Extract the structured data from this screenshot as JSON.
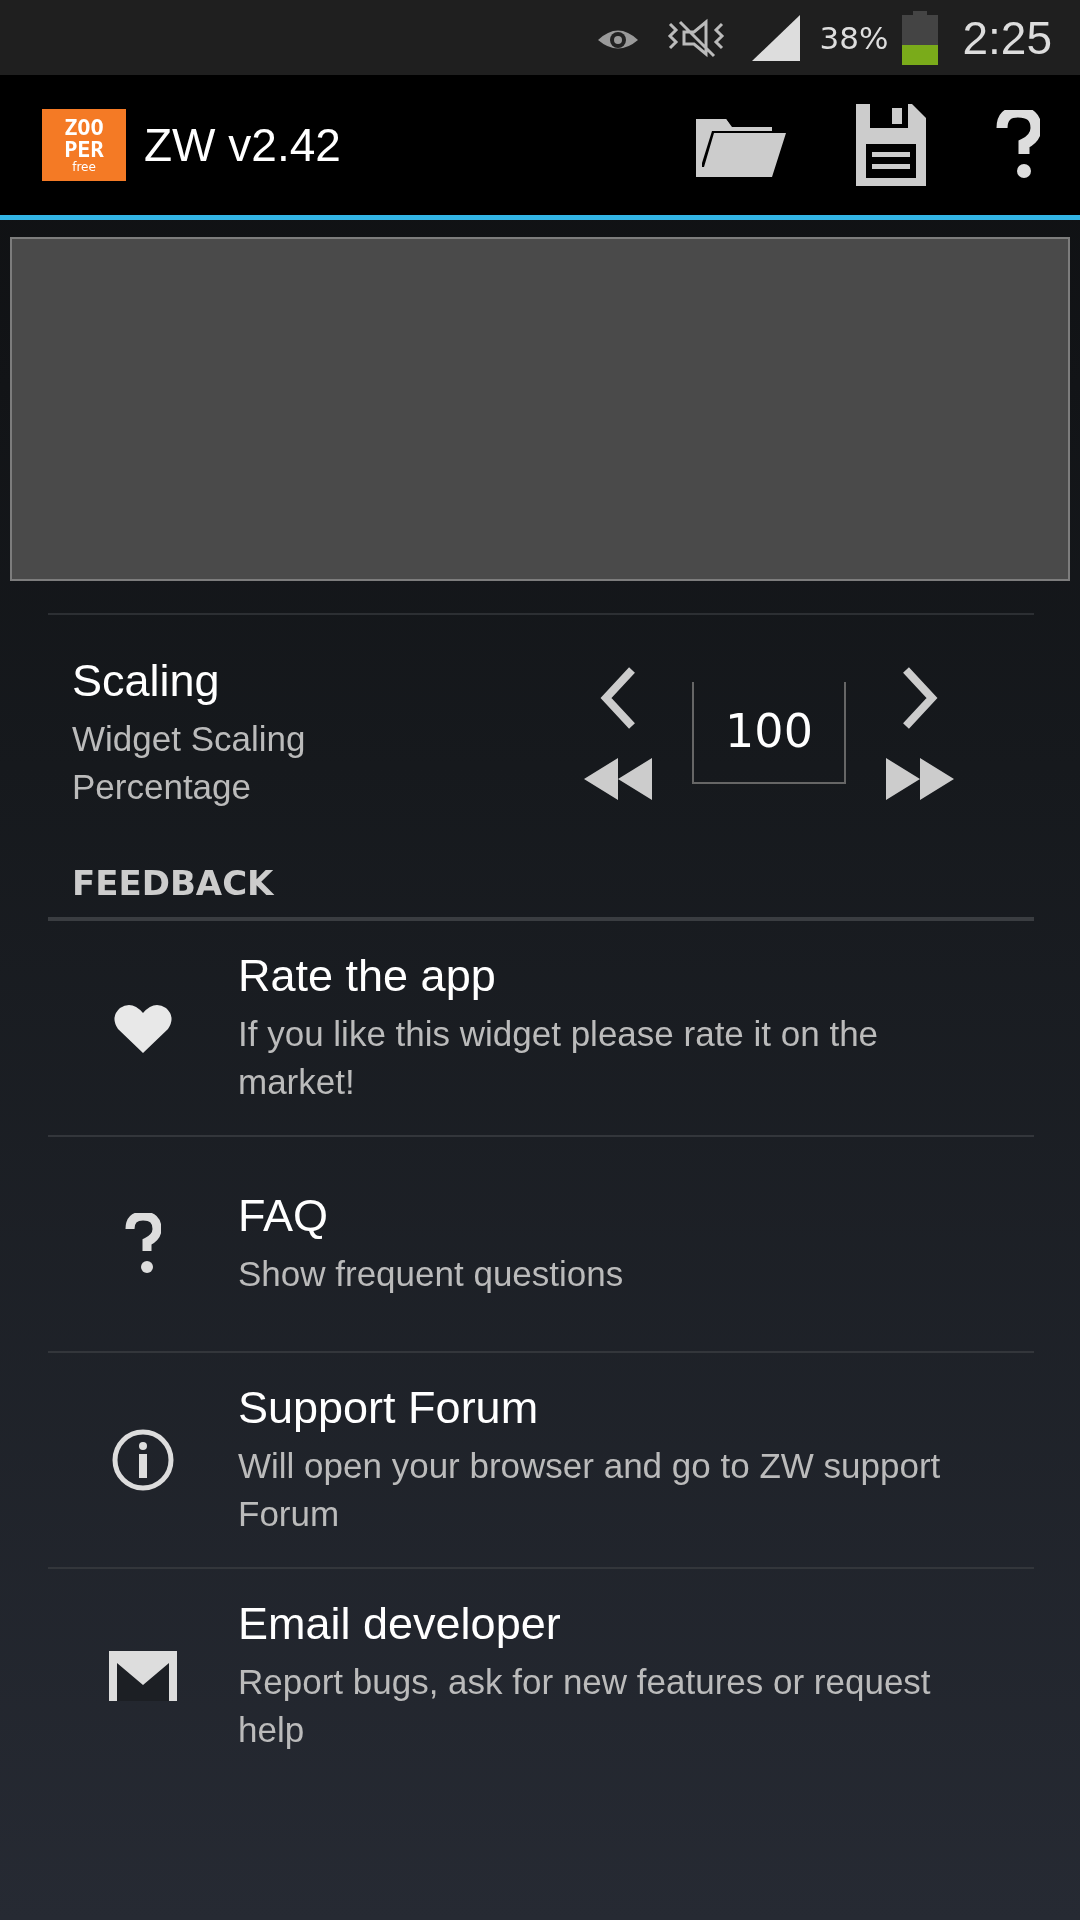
{
  "status_bar": {
    "battery": "38%",
    "time": "2:25"
  },
  "action_bar": {
    "logo": [
      "ZOO",
      "PER",
      "free"
    ],
    "title": "ZW v2.42"
  },
  "scaling": {
    "title": "Scaling",
    "subtitle": "Widget Scaling Percentage",
    "value": "100"
  },
  "section": "FEEDBACK",
  "items": [
    {
      "kind": "heart",
      "title": "Rate the app",
      "subtitle": "If you like this widget please rate it on the market!"
    },
    {
      "kind": "question",
      "title": "FAQ",
      "subtitle": "Show frequent questions"
    },
    {
      "kind": "info",
      "title": "Support Forum",
      "subtitle": "Will open your browser and go to ZW support Forum"
    },
    {
      "kind": "mail",
      "title": "Email developer",
      "subtitle": "Report bugs, ask for new features or request help"
    }
  ]
}
